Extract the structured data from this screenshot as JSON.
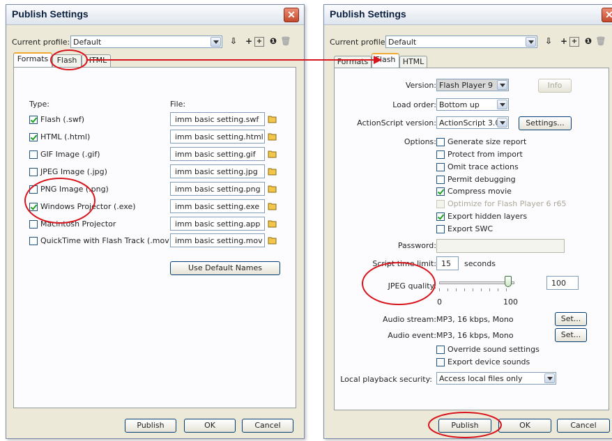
{
  "left_dialog": {
    "title": "Publish Settings",
    "profile_label": "Current profile:",
    "profile_value": "Default",
    "tabs": [
      {
        "label": "Formats",
        "active": true
      },
      {
        "label": "Flash",
        "active": false
      },
      {
        "label": "HTML",
        "active": false
      }
    ],
    "type_header": "Type:",
    "file_header": "File:",
    "formats": [
      {
        "type": "Flash  (.swf)",
        "checked": true,
        "file": "imm basic setting.swf"
      },
      {
        "type": "HTML  (.html)",
        "checked": true,
        "file": "imm basic setting.html"
      },
      {
        "type": "GIF Image  (.gif)",
        "checked": false,
        "file": "imm basic setting.gif"
      },
      {
        "type": "JPEG Image  (.jpg)",
        "checked": false,
        "file": "imm basic setting.jpg"
      },
      {
        "type": "PNG Image  (.png)",
        "checked": false,
        "file": "imm basic setting.png"
      },
      {
        "type": "Windows Projector  (.exe)",
        "checked": true,
        "file": "imm basic setting.exe"
      },
      {
        "type": "Macintosh Projector",
        "checked": false,
        "file": "imm basic setting.app"
      },
      {
        "type": "QuickTime with Flash Track  (.mov)",
        "checked": false,
        "file": "imm basic setting.mov"
      }
    ],
    "use_default_names": "Use Default Names",
    "buttons": {
      "publish": "Publish",
      "ok": "OK",
      "cancel": "Cancel"
    }
  },
  "right_dialog": {
    "title": "Publish Settings",
    "profile_label": "Current profile:",
    "profile_value": "Default",
    "tabs": [
      {
        "label": "Formats",
        "active": false
      },
      {
        "label": "Flash",
        "active": true
      },
      {
        "label": "HTML",
        "active": false
      }
    ],
    "version_label": "Version:",
    "version_value": "Flash Player 9",
    "info_button": "Info",
    "load_order_label": "Load order:",
    "load_order_value": "Bottom up",
    "actionscript_label": "ActionScript version:",
    "actionscript_value": "ActionScript 3.0",
    "settings_button": "Settings...",
    "options_label": "Options:",
    "options": [
      {
        "label": "Generate size report",
        "checked": false,
        "disabled": false
      },
      {
        "label": "Protect from import",
        "checked": false,
        "disabled": false
      },
      {
        "label": "Omit trace actions",
        "checked": false,
        "disabled": false
      },
      {
        "label": "Permit debugging",
        "checked": false,
        "disabled": false
      },
      {
        "label": "Compress movie",
        "checked": true,
        "disabled": false
      },
      {
        "label": "Optimize for Flash Player 6 r65",
        "checked": false,
        "disabled": true
      },
      {
        "label": "Export hidden layers",
        "checked": true,
        "disabled": false
      },
      {
        "label": "Export SWC",
        "checked": false,
        "disabled": false
      }
    ],
    "password_label": "Password:",
    "password_value": "",
    "script_time_label": "Script time limit:",
    "script_time_value": "15",
    "seconds_label": "seconds",
    "jpeg_label": "JPEG quality:",
    "jpeg_value": "100",
    "jpeg_slider_fraction": 1.0,
    "jpeg_min": "0",
    "jpeg_max": "100",
    "audio_stream_label": "Audio stream:",
    "audio_stream_value": "MP3, 16 kbps, Mono",
    "audio_event_label": "Audio event:",
    "audio_event_value": "MP3, 16 kbps, Mono",
    "set_button": "Set...",
    "override_sound": "Override sound settings",
    "export_device_sounds": "Export device sounds",
    "local_playback_label": "Local playback security:",
    "local_playback_value": "Access local files only",
    "buttons": {
      "publish": "Publish",
      "ok": "OK",
      "cancel": "Cancel"
    }
  },
  "annotation_color": "#d8141c",
  "icons": [
    "close-icon",
    "import-export-icon",
    "add-profile-icon",
    "duplicate-profile-icon",
    "info-icon",
    "delete-profile-icon",
    "folder-icon"
  ]
}
